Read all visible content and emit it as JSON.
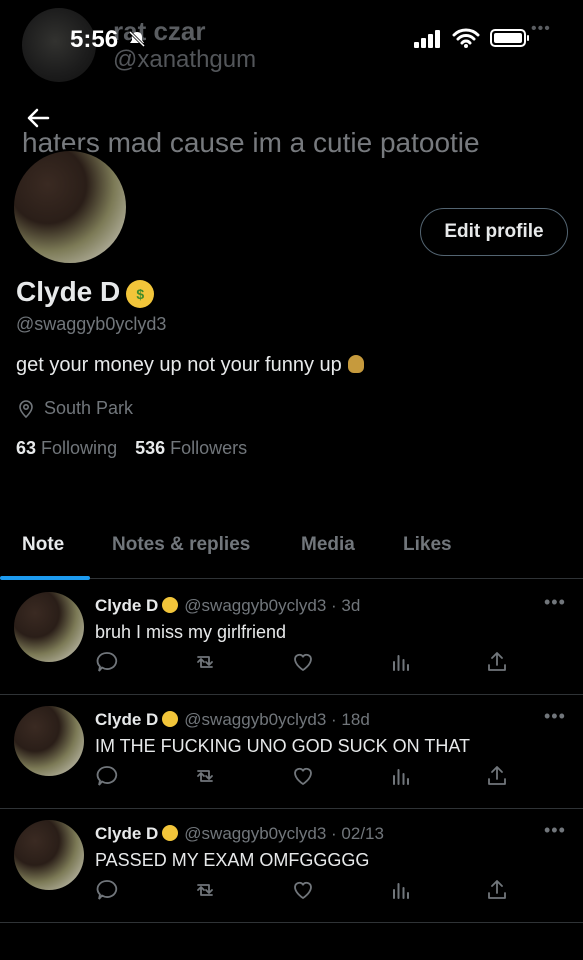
{
  "ghost": {
    "name": "rat czar",
    "handle": "@xanathgum",
    "bio": "haters mad cause im a cutie patootie"
  },
  "status_bar": {
    "time": "5:56",
    "icons": [
      "mute-icon",
      "signal-icon",
      "wifi-icon",
      "battery-icon"
    ]
  },
  "profile": {
    "display_name": "Clyde D",
    "handle": "@swaggyb0yclyd3",
    "bio": "get your money up not your funny up",
    "location": "South Park",
    "following_count": "63",
    "following_label": "Following",
    "followers_count": "536",
    "followers_label": "Followers",
    "edit_label": "Edit profile"
  },
  "tabs": [
    "Note",
    "Notes & replies",
    "Media",
    "Likes"
  ],
  "active_tab": "Note",
  "tweets": [
    {
      "name": "Clyde D",
      "handle": "@swaggyb0yclyd3",
      "time": "3d",
      "text": "bruh I miss my girlfriend"
    },
    {
      "name": "Clyde D",
      "handle": "@swaggyb0yclyd3",
      "time": "18d",
      "text": "IM THE FUCKING UNO GOD SUCK ON THAT"
    },
    {
      "name": "Clyde D",
      "handle": "@swaggyb0yclyd3",
      "time": "02/13",
      "text": "PASSED MY EXAM OMFGGGGG"
    }
  ],
  "colors": {
    "background": "#000000",
    "text": "#e7e9ea",
    "muted": "#71767b",
    "accent": "#1d9bf0",
    "divider": "#2f3336"
  }
}
